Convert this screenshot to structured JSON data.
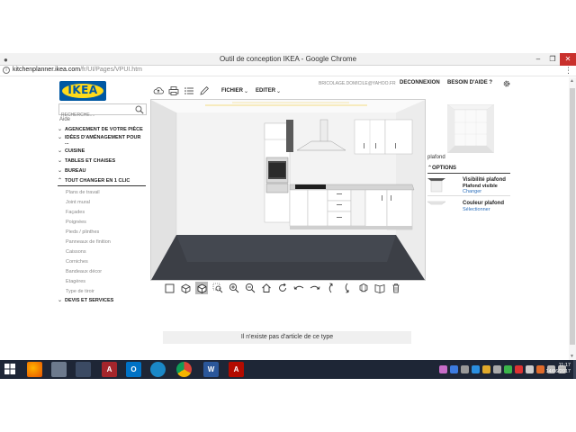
{
  "window": {
    "title": "Outil de conception IKEA - Google Chrome",
    "minimize_glyph": "–",
    "restore_glyph": "❐",
    "close_glyph": "✕"
  },
  "address": {
    "domain": "kitchenplanner.ikea.com",
    "path": "/fr/UI/Pages/VPUI.htm"
  },
  "header": {
    "logo_text": "IKEA",
    "search_placeholder": "RECHERCHE....",
    "aide": "Aide",
    "email": "BRICOLAGE.DOMICILE@YAHOO.FR",
    "deconnexion": "DECONNEXION",
    "besoin_aide": "BESOIN D'AIDE ?"
  },
  "toolbar": {
    "fichier": "FICHIER",
    "editer": "EDITER"
  },
  "sidebar": {
    "categories": [
      {
        "label": "AGENCEMENT DE VOTRE PIÈCE",
        "state": "collapsed"
      },
      {
        "label": "IDÉES D'AMÉNAGEMENT POUR ...",
        "state": "collapsed"
      },
      {
        "label": "CUISINE",
        "state": "collapsed"
      },
      {
        "label": "TABLES ET CHAISES",
        "state": "collapsed"
      },
      {
        "label": "BUREAU",
        "state": "collapsed"
      },
      {
        "label": "TOUT CHANGER EN 1 CLIC",
        "state": "expanded"
      }
    ],
    "subitems": [
      "Plans de travail",
      "Joint mural",
      "Façades",
      "Poignées",
      "Pieds / plinthes",
      "Panneaux de finition",
      "Caissons",
      "Corniches",
      "Bandeaux décor",
      "Etagères",
      "Type de tiroir"
    ],
    "last_category": {
      "label": "DEVIS ET SERVICES",
      "state": "collapsed"
    }
  },
  "right_panel": {
    "preview_label": "plafond",
    "options_header": "OPTIONS",
    "option1": {
      "title": "Visibilité plafond",
      "value": "Plafond visible",
      "action": "Changer"
    },
    "option2": {
      "title": "Couleur plafond",
      "action": "Sélectionner"
    }
  },
  "status": {
    "message": "Il n'existe pas d'article de ce type"
  },
  "taskbar": {
    "clock_time": "11:17",
    "clock_date": "14/06/2017"
  },
  "colors": {
    "ikea_blue": "#0058a3",
    "ikea_yellow": "#ffda1a",
    "link_blue": "#2a6ebb",
    "taskbar": "#1e2636"
  }
}
